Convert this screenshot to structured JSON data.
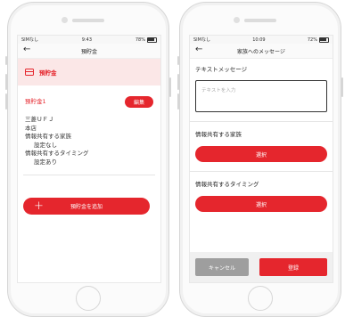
{
  "left_phone": {
    "status": {
      "carrier": "SIMなし",
      "time": "9:43",
      "battery": "78%"
    },
    "nav": {
      "title": "預貯金"
    },
    "section_title": "預貯金",
    "account": {
      "name": "預貯金1",
      "edit_label": "編集",
      "lines": [
        "三菱ＵＦＪ",
        "本店",
        "情報共有する家族",
        "設定なし",
        "情報共有するタイミング",
        "設定あり"
      ]
    },
    "add_button_label": "預貯金を追加"
  },
  "right_phone": {
    "status": {
      "carrier": "SIMなし",
      "time": "10:09",
      "battery": "72%"
    },
    "nav": {
      "title": "家族へのメッセージ"
    },
    "text_message_label": "テキストメッセージ",
    "text_placeholder": "テキストを入力",
    "family_label": "情報共有する家族",
    "family_select_label": "選択",
    "timing_label": "情報共有するタイミング",
    "timing_select_label": "選択",
    "cancel_label": "キャンセル",
    "submit_label": "登録"
  },
  "colors": {
    "accent": "#e5262d",
    "section_bg": "#fbe7e7",
    "cancel": "#9e9e9e"
  },
  "icons": [
    "back-arrow-icon",
    "wifi-icon",
    "battery-icon",
    "card-icon",
    "plus-icon"
  ]
}
